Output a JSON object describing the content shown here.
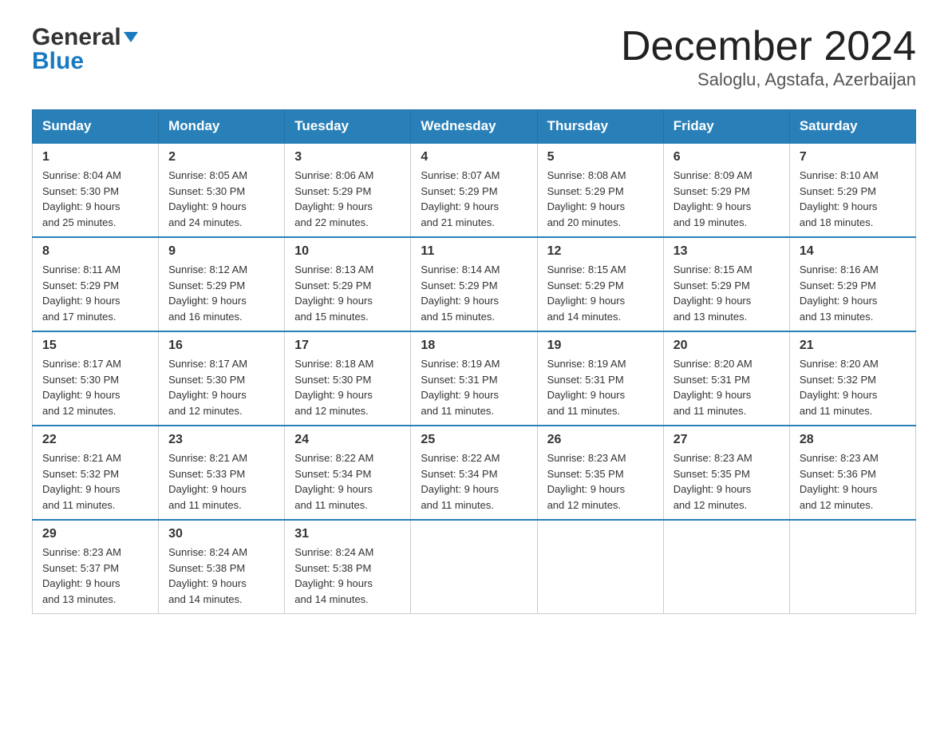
{
  "header": {
    "logo_general": "General",
    "logo_blue": "Blue",
    "month_title": "December 2024",
    "location": "Saloglu, Agstafa, Azerbaijan"
  },
  "weekdays": [
    "Sunday",
    "Monday",
    "Tuesday",
    "Wednesday",
    "Thursday",
    "Friday",
    "Saturday"
  ],
  "weeks": [
    [
      {
        "day": "1",
        "sunrise": "8:04 AM",
        "sunset": "5:30 PM",
        "daylight": "9 hours and 25 minutes."
      },
      {
        "day": "2",
        "sunrise": "8:05 AM",
        "sunset": "5:30 PM",
        "daylight": "9 hours and 24 minutes."
      },
      {
        "day": "3",
        "sunrise": "8:06 AM",
        "sunset": "5:29 PM",
        "daylight": "9 hours and 22 minutes."
      },
      {
        "day": "4",
        "sunrise": "8:07 AM",
        "sunset": "5:29 PM",
        "daylight": "9 hours and 21 minutes."
      },
      {
        "day": "5",
        "sunrise": "8:08 AM",
        "sunset": "5:29 PM",
        "daylight": "9 hours and 20 minutes."
      },
      {
        "day": "6",
        "sunrise": "8:09 AM",
        "sunset": "5:29 PM",
        "daylight": "9 hours and 19 minutes."
      },
      {
        "day": "7",
        "sunrise": "8:10 AM",
        "sunset": "5:29 PM",
        "daylight": "9 hours and 18 minutes."
      }
    ],
    [
      {
        "day": "8",
        "sunrise": "8:11 AM",
        "sunset": "5:29 PM",
        "daylight": "9 hours and 17 minutes."
      },
      {
        "day": "9",
        "sunrise": "8:12 AM",
        "sunset": "5:29 PM",
        "daylight": "9 hours and 16 minutes."
      },
      {
        "day": "10",
        "sunrise": "8:13 AM",
        "sunset": "5:29 PM",
        "daylight": "9 hours and 15 minutes."
      },
      {
        "day": "11",
        "sunrise": "8:14 AM",
        "sunset": "5:29 PM",
        "daylight": "9 hours and 15 minutes."
      },
      {
        "day": "12",
        "sunrise": "8:15 AM",
        "sunset": "5:29 PM",
        "daylight": "9 hours and 14 minutes."
      },
      {
        "day": "13",
        "sunrise": "8:15 AM",
        "sunset": "5:29 PM",
        "daylight": "9 hours and 13 minutes."
      },
      {
        "day": "14",
        "sunrise": "8:16 AM",
        "sunset": "5:29 PM",
        "daylight": "9 hours and 13 minutes."
      }
    ],
    [
      {
        "day": "15",
        "sunrise": "8:17 AM",
        "sunset": "5:30 PM",
        "daylight": "9 hours and 12 minutes."
      },
      {
        "day": "16",
        "sunrise": "8:17 AM",
        "sunset": "5:30 PM",
        "daylight": "9 hours and 12 minutes."
      },
      {
        "day": "17",
        "sunrise": "8:18 AM",
        "sunset": "5:30 PM",
        "daylight": "9 hours and 12 minutes."
      },
      {
        "day": "18",
        "sunrise": "8:19 AM",
        "sunset": "5:31 PM",
        "daylight": "9 hours and 11 minutes."
      },
      {
        "day": "19",
        "sunrise": "8:19 AM",
        "sunset": "5:31 PM",
        "daylight": "9 hours and 11 minutes."
      },
      {
        "day": "20",
        "sunrise": "8:20 AM",
        "sunset": "5:31 PM",
        "daylight": "9 hours and 11 minutes."
      },
      {
        "day": "21",
        "sunrise": "8:20 AM",
        "sunset": "5:32 PM",
        "daylight": "9 hours and 11 minutes."
      }
    ],
    [
      {
        "day": "22",
        "sunrise": "8:21 AM",
        "sunset": "5:32 PM",
        "daylight": "9 hours and 11 minutes."
      },
      {
        "day": "23",
        "sunrise": "8:21 AM",
        "sunset": "5:33 PM",
        "daylight": "9 hours and 11 minutes."
      },
      {
        "day": "24",
        "sunrise": "8:22 AM",
        "sunset": "5:34 PM",
        "daylight": "9 hours and 11 minutes."
      },
      {
        "day": "25",
        "sunrise": "8:22 AM",
        "sunset": "5:34 PM",
        "daylight": "9 hours and 11 minutes."
      },
      {
        "day": "26",
        "sunrise": "8:23 AM",
        "sunset": "5:35 PM",
        "daylight": "9 hours and 12 minutes."
      },
      {
        "day": "27",
        "sunrise": "8:23 AM",
        "sunset": "5:35 PM",
        "daylight": "9 hours and 12 minutes."
      },
      {
        "day": "28",
        "sunrise": "8:23 AM",
        "sunset": "5:36 PM",
        "daylight": "9 hours and 12 minutes."
      }
    ],
    [
      {
        "day": "29",
        "sunrise": "8:23 AM",
        "sunset": "5:37 PM",
        "daylight": "9 hours and 13 minutes."
      },
      {
        "day": "30",
        "sunrise": "8:24 AM",
        "sunset": "5:38 PM",
        "daylight": "9 hours and 14 minutes."
      },
      {
        "day": "31",
        "sunrise": "8:24 AM",
        "sunset": "5:38 PM",
        "daylight": "9 hours and 14 minutes."
      },
      null,
      null,
      null,
      null
    ]
  ],
  "labels": {
    "sunrise": "Sunrise:",
    "sunset": "Sunset:",
    "daylight": "Daylight:"
  }
}
